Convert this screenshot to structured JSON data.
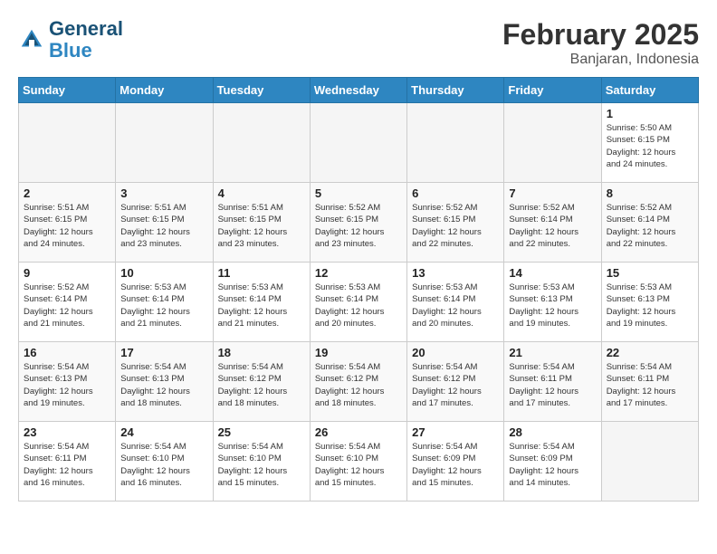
{
  "header": {
    "logo_line1": "General",
    "logo_line2": "Blue",
    "month_year": "February 2025",
    "location": "Banjaran, Indonesia"
  },
  "weekdays": [
    "Sunday",
    "Monday",
    "Tuesday",
    "Wednesday",
    "Thursday",
    "Friday",
    "Saturday"
  ],
  "weeks": [
    [
      {
        "day": "",
        "info": ""
      },
      {
        "day": "",
        "info": ""
      },
      {
        "day": "",
        "info": ""
      },
      {
        "day": "",
        "info": ""
      },
      {
        "day": "",
        "info": ""
      },
      {
        "day": "",
        "info": ""
      },
      {
        "day": "1",
        "info": "Sunrise: 5:50 AM\nSunset: 6:15 PM\nDaylight: 12 hours\nand 24 minutes."
      }
    ],
    [
      {
        "day": "2",
        "info": "Sunrise: 5:51 AM\nSunset: 6:15 PM\nDaylight: 12 hours\nand 24 minutes."
      },
      {
        "day": "3",
        "info": "Sunrise: 5:51 AM\nSunset: 6:15 PM\nDaylight: 12 hours\nand 23 minutes."
      },
      {
        "day": "4",
        "info": "Sunrise: 5:51 AM\nSunset: 6:15 PM\nDaylight: 12 hours\nand 23 minutes."
      },
      {
        "day": "5",
        "info": "Sunrise: 5:52 AM\nSunset: 6:15 PM\nDaylight: 12 hours\nand 23 minutes."
      },
      {
        "day": "6",
        "info": "Sunrise: 5:52 AM\nSunset: 6:15 PM\nDaylight: 12 hours\nand 22 minutes."
      },
      {
        "day": "7",
        "info": "Sunrise: 5:52 AM\nSunset: 6:14 PM\nDaylight: 12 hours\nand 22 minutes."
      },
      {
        "day": "8",
        "info": "Sunrise: 5:52 AM\nSunset: 6:14 PM\nDaylight: 12 hours\nand 22 minutes."
      }
    ],
    [
      {
        "day": "9",
        "info": "Sunrise: 5:52 AM\nSunset: 6:14 PM\nDaylight: 12 hours\nand 21 minutes."
      },
      {
        "day": "10",
        "info": "Sunrise: 5:53 AM\nSunset: 6:14 PM\nDaylight: 12 hours\nand 21 minutes."
      },
      {
        "day": "11",
        "info": "Sunrise: 5:53 AM\nSunset: 6:14 PM\nDaylight: 12 hours\nand 21 minutes."
      },
      {
        "day": "12",
        "info": "Sunrise: 5:53 AM\nSunset: 6:14 PM\nDaylight: 12 hours\nand 20 minutes."
      },
      {
        "day": "13",
        "info": "Sunrise: 5:53 AM\nSunset: 6:14 PM\nDaylight: 12 hours\nand 20 minutes."
      },
      {
        "day": "14",
        "info": "Sunrise: 5:53 AM\nSunset: 6:13 PM\nDaylight: 12 hours\nand 19 minutes."
      },
      {
        "day": "15",
        "info": "Sunrise: 5:53 AM\nSunset: 6:13 PM\nDaylight: 12 hours\nand 19 minutes."
      }
    ],
    [
      {
        "day": "16",
        "info": "Sunrise: 5:54 AM\nSunset: 6:13 PM\nDaylight: 12 hours\nand 19 minutes."
      },
      {
        "day": "17",
        "info": "Sunrise: 5:54 AM\nSunset: 6:13 PM\nDaylight: 12 hours\nand 18 minutes."
      },
      {
        "day": "18",
        "info": "Sunrise: 5:54 AM\nSunset: 6:12 PM\nDaylight: 12 hours\nand 18 minutes."
      },
      {
        "day": "19",
        "info": "Sunrise: 5:54 AM\nSunset: 6:12 PM\nDaylight: 12 hours\nand 18 minutes."
      },
      {
        "day": "20",
        "info": "Sunrise: 5:54 AM\nSunset: 6:12 PM\nDaylight: 12 hours\nand 17 minutes."
      },
      {
        "day": "21",
        "info": "Sunrise: 5:54 AM\nSunset: 6:11 PM\nDaylight: 12 hours\nand 17 minutes."
      },
      {
        "day": "22",
        "info": "Sunrise: 5:54 AM\nSunset: 6:11 PM\nDaylight: 12 hours\nand 17 minutes."
      }
    ],
    [
      {
        "day": "23",
        "info": "Sunrise: 5:54 AM\nSunset: 6:11 PM\nDaylight: 12 hours\nand 16 minutes."
      },
      {
        "day": "24",
        "info": "Sunrise: 5:54 AM\nSunset: 6:10 PM\nDaylight: 12 hours\nand 16 minutes."
      },
      {
        "day": "25",
        "info": "Sunrise: 5:54 AM\nSunset: 6:10 PM\nDaylight: 12 hours\nand 15 minutes."
      },
      {
        "day": "26",
        "info": "Sunrise: 5:54 AM\nSunset: 6:10 PM\nDaylight: 12 hours\nand 15 minutes."
      },
      {
        "day": "27",
        "info": "Sunrise: 5:54 AM\nSunset: 6:09 PM\nDaylight: 12 hours\nand 15 minutes."
      },
      {
        "day": "28",
        "info": "Sunrise: 5:54 AM\nSunset: 6:09 PM\nDaylight: 12 hours\nand 14 minutes."
      },
      {
        "day": "",
        "info": ""
      }
    ]
  ]
}
